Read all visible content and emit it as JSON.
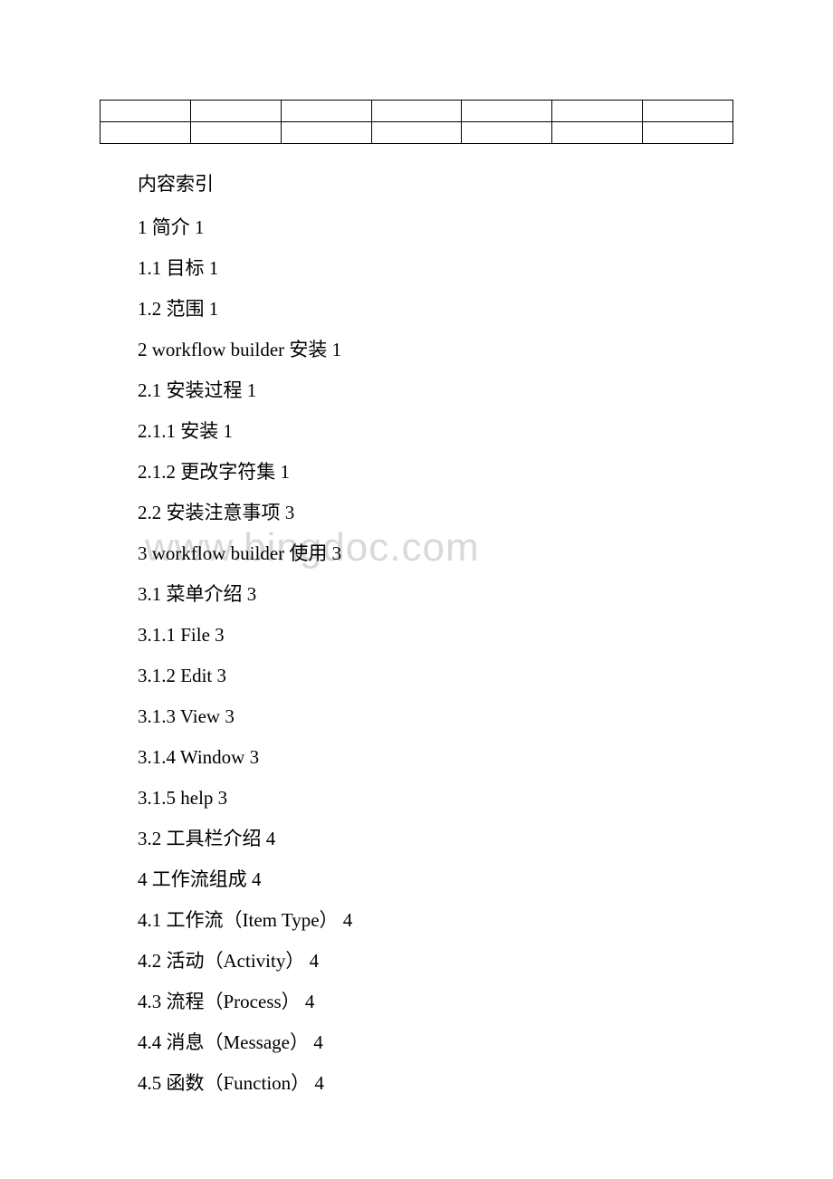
{
  "watermark": "www.bingdoc.com",
  "toc": {
    "title": "内容索引",
    "entries": [
      "1 简介 1",
      "1.1 目标 1",
      "1.2 范围 1",
      "2 workflow builder 安装 1",
      "2.1 安装过程 1",
      "2.1.1 安装 1",
      "2.1.2 更改字符集 1",
      "2.2 安装注意事项 3",
      "3 workflow builder 使用 3",
      "3.1 菜单介绍 3",
      "3.1.1 File 3",
      "3.1.2 Edit 3",
      "3.1.3 View 3",
      "3.1.4 Window 3",
      "3.1.5 help 3",
      "3.2 工具栏介绍 4",
      "4 工作流组成 4",
      "4.1 工作流（Item Type） 4",
      "4.2 活动（Activity） 4",
      "4.3 流程（Process） 4",
      "4.4 消息（Message） 4",
      "4.5 函数（Function） 4"
    ]
  },
  "table": {
    "rows": 2,
    "cols": 7
  }
}
